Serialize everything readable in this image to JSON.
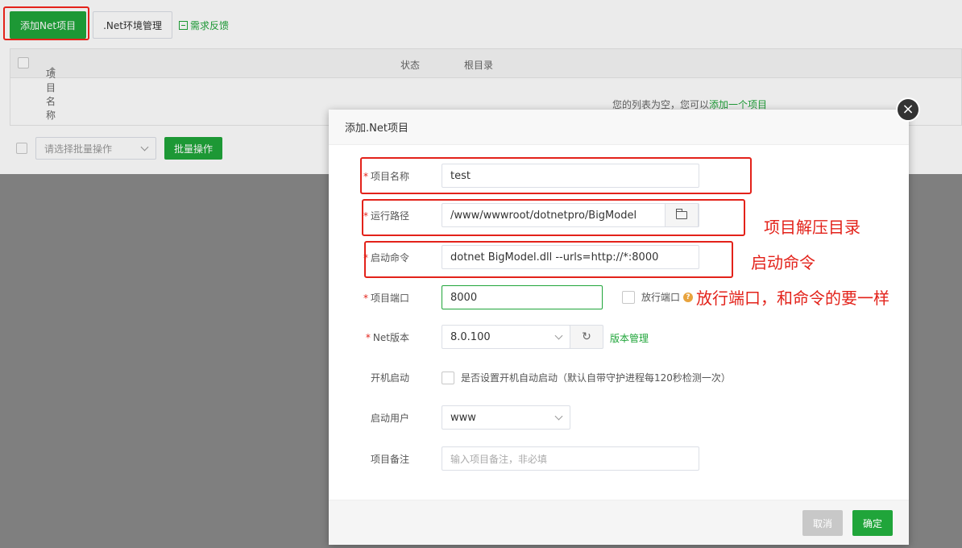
{
  "toolbar": {
    "add_project_label": "添加Net项目",
    "env_manage_label": ".Net环境管理",
    "feedback_label": "需求反馈"
  },
  "table": {
    "columns": [
      "项目名称",
      "状态",
      "根目录"
    ],
    "empty_text": "您的列表为空，您可以",
    "empty_link": "添加一个项目"
  },
  "batch": {
    "select_placeholder": "请选择批量操作",
    "button_label": "批量操作"
  },
  "modal": {
    "title": "添加.Net项目",
    "close_glyph": "×",
    "fields": {
      "project_name": {
        "label": "项目名称",
        "value": "test"
      },
      "run_path": {
        "label": "运行路径",
        "value": "/www/wwwroot/dotnetpro/BigModel"
      },
      "start_command": {
        "label": "启动命令",
        "value": "dotnet BigModel.dll --urls=http://*:8000"
      },
      "project_port": {
        "label": "项目端口",
        "value": "8000",
        "release_port_label": "放行端口"
      },
      "net_version": {
        "label": "Net版本",
        "value": "8.0.100",
        "manage_link": "版本管理"
      },
      "autostart": {
        "label": "开机启动",
        "checkbox_label": "是否设置开机自动启动（默认自带守护进程每120秒检测一次）"
      },
      "start_user": {
        "label": "启动用户",
        "value": "www"
      },
      "remark": {
        "label": "项目备注",
        "placeholder": "输入项目备注，非必填"
      }
    },
    "cancel_label": "取消",
    "ok_label": "确定"
  },
  "annotations": {
    "path_note": "项目解压目录",
    "command_note": "启动命令",
    "port_note": "放行端口，和命令的要一样"
  },
  "colors": {
    "accent": "#20a53a",
    "annotation_red": "#e3221a"
  }
}
